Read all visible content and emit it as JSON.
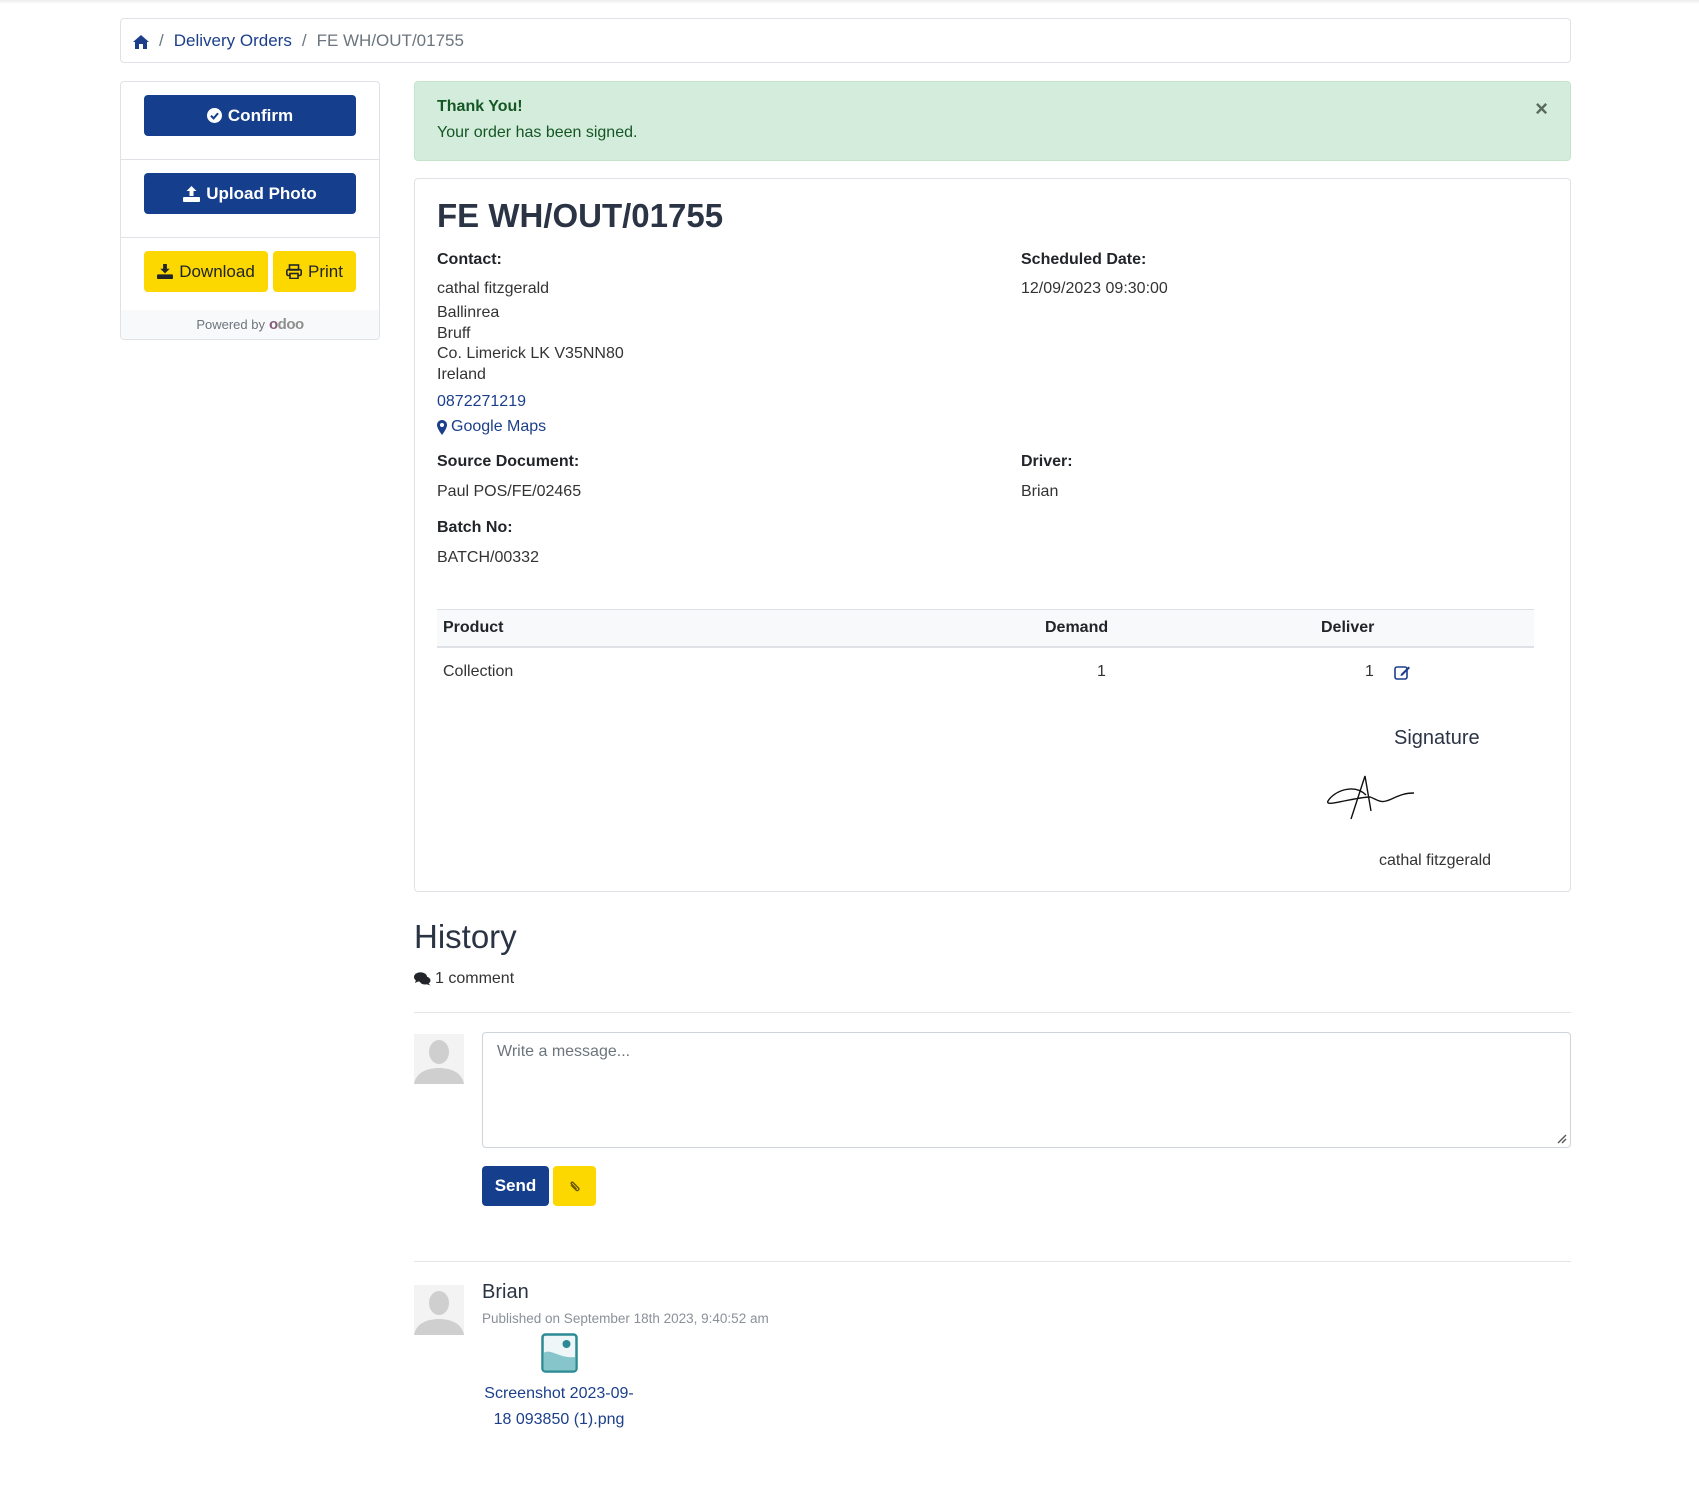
{
  "breadcrumb": {
    "home_icon": "home-icon",
    "items": [
      {
        "label": "Delivery Orders",
        "link": true
      },
      {
        "label": "FE WH/OUT/01755",
        "link": false
      }
    ],
    "separator": "/"
  },
  "sidebar": {
    "confirm_label": "Confirm",
    "confirm_icon": "check-circle-icon",
    "upload_label": "Upload Photo",
    "upload_icon": "upload-icon",
    "download_label": "Download",
    "download_icon": "download-icon",
    "print_label": "Print",
    "print_icon": "print-icon",
    "powered_by": "Powered by",
    "brand": "odoo"
  },
  "alert": {
    "title": "Thank You!",
    "message": "Your order has been signed.",
    "close": "×"
  },
  "order": {
    "title": "FE WH/OUT/01755",
    "contact_label": "Contact:",
    "contact_name": "cathal fitzgerald",
    "address_lines": [
      "Ballinrea",
      "Bruff",
      "Co. Limerick LK V35NN80",
      "Ireland"
    ],
    "phone": "0872271219",
    "maps_label": "Google Maps",
    "scheduled_label": "Scheduled Date:",
    "scheduled_value": "12/09/2023 09:30:00",
    "source_label": "Source Document:",
    "source_value": "Paul POS/FE/02465",
    "driver_label": "Driver:",
    "driver_value": "Brian",
    "batch_label": "Batch No:",
    "batch_value": "BATCH/00332"
  },
  "table": {
    "headers": [
      "Product",
      "Demand",
      "Deliver"
    ],
    "rows": [
      {
        "product": "Collection",
        "demand": "1",
        "deliver": "1"
      }
    ]
  },
  "signature": {
    "title": "Signature",
    "name": "cathal fitzgerald"
  },
  "history": {
    "title": "History",
    "comment_count": "1 comment",
    "composer": {
      "placeholder": "Write a message...",
      "send_label": "Send",
      "attach_icon": "paperclip-icon"
    },
    "messages": [
      {
        "author": "Brian",
        "published": "Published on September 18th 2023, 9:40:52 am",
        "attachment": {
          "name": "Screenshot 2023-09-18 093850 (1).png",
          "icon": "image-file-icon"
        }
      }
    ]
  },
  "colors": {
    "primary": "#153e8c",
    "accent_yellow": "#fcd700",
    "success_bg": "#d4ecdb",
    "link": "#1b3f8b"
  }
}
